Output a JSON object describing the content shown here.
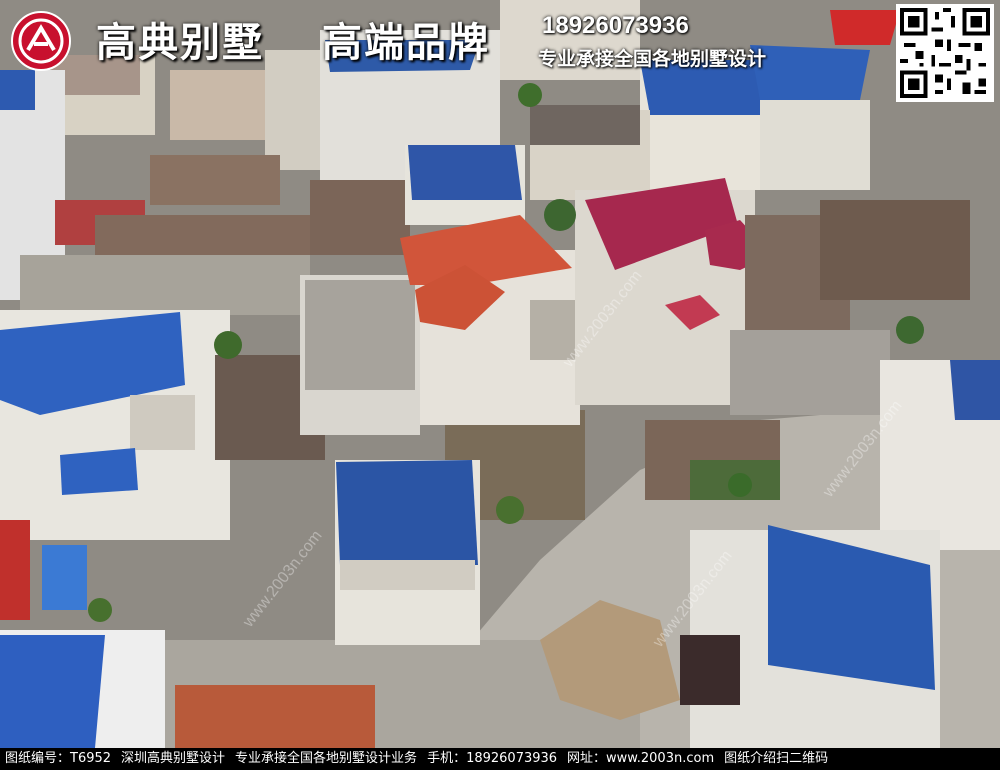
{
  "header": {
    "brand_name": "高典别墅",
    "brand_slogan": "高端品牌",
    "phone": "18926073936",
    "tagline": "专业承接全国各地别墅设计",
    "logo_icon": "gaodian-logo-icon",
    "qr_icon": "qr-code-icon"
  },
  "watermark": {
    "url_text": "www.2003n.com"
  },
  "footer": {
    "drawing_no": "图纸编号：T6952",
    "company": "深圳高典别墅设计",
    "service": "专业承接全国各地别墅设计业务",
    "phone": "手机：18926073936",
    "website": "网址：www.2003n.com",
    "qr_note": "图纸介绍扫二维码"
  }
}
